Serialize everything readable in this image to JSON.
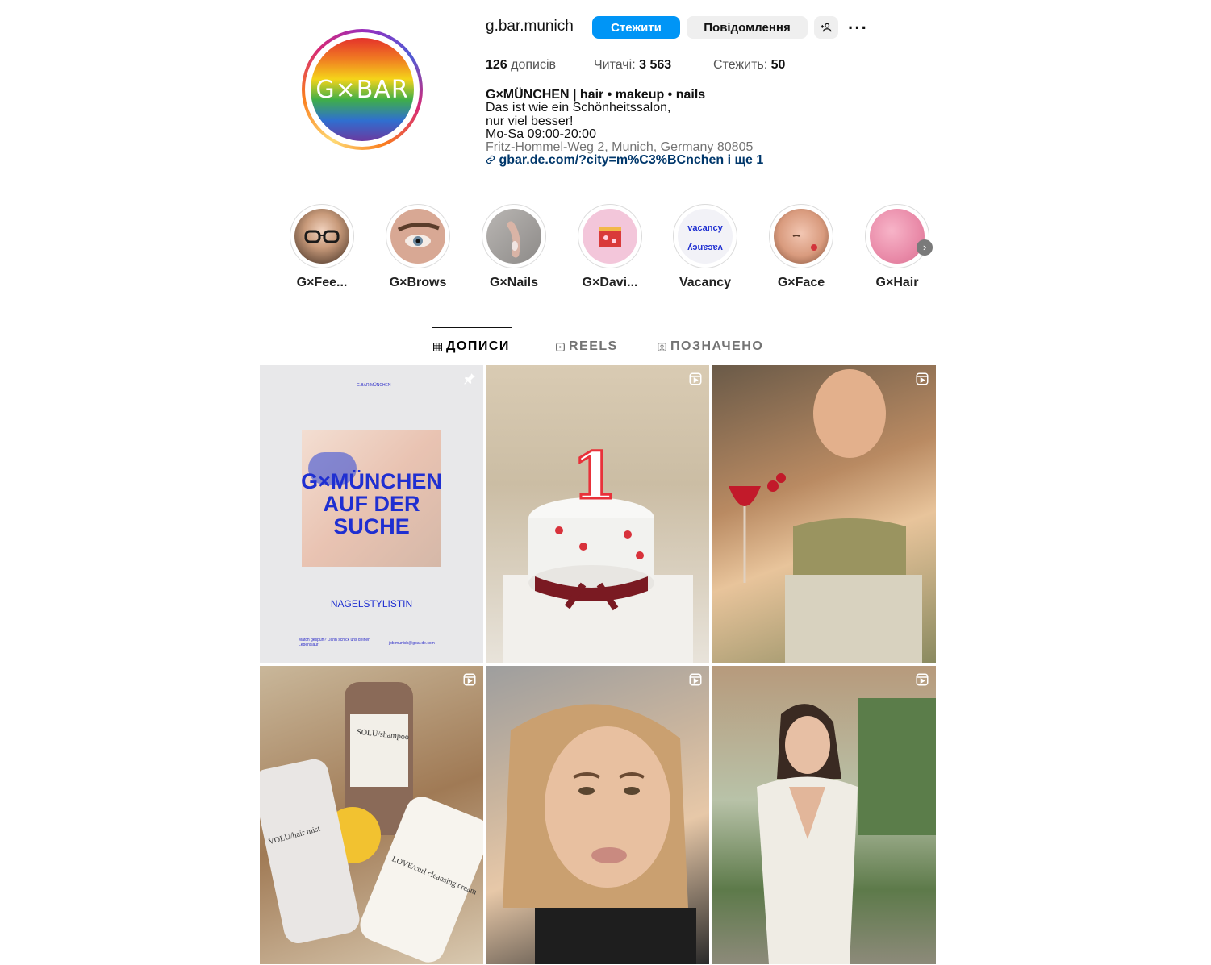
{
  "profile": {
    "username": "g.bar.munich",
    "avatar_text": "G×BAR",
    "follow_label": "Стежити",
    "message_label": "Повідомлення",
    "suggest_icon": "add-person-icon",
    "more_icon": "more-icon"
  },
  "stats": {
    "posts_count": "126",
    "posts_label": "дописів",
    "followers_label": "Читачі:",
    "followers_count": "3 563",
    "following_label": "Стежить:",
    "following_count": "50"
  },
  "bio": {
    "name": "G×MÜNCHEN | hair • makeup • nails",
    "line1": "Das ist wie ein Schönheitssalon,",
    "line2": "nur viel besser!",
    "hours": "Mo-Sa 09:00-20:00",
    "address": "Fritz-Hommel-Weg 2, Munich, Germany 80805",
    "link": "gbar.de.com/?city=m%C3%BCnchen і ще 1"
  },
  "highlights": [
    {
      "label": "G×Fee..."
    },
    {
      "label": "G×Brows"
    },
    {
      "label": "G×Nails"
    },
    {
      "label": "G×Davi..."
    },
    {
      "label": "Vacancy"
    },
    {
      "label": "G×Face"
    },
    {
      "label": "G×Hair"
    }
  ],
  "vacancy_art": {
    "text": "vacancy"
  },
  "tabs": {
    "posts": "ДОПИСИ",
    "reels": "REELS",
    "tagged": "ПОЗНАЧЕНО"
  },
  "posts": {
    "poster_brand": "G.BAR.MÜNCHEN",
    "poster_line1": "G×MÜNCHEN",
    "poster_line2": "AUF DER",
    "poster_line3": "SUCHE",
    "poster_sub": "NAGELSTYLISTIN",
    "poster_footer_left": "Match gespürt? Dann schick uns deinen Lebenslauf",
    "poster_footer_right": "job.munich@gbar.de.com",
    "cake_number": "1",
    "bottle1": "SOLU/shampoo",
    "bottle2": "VOLU/hair mist",
    "bottle3": "LOVE/curl cleansing cream"
  },
  "colors": {
    "accent": "#0095f6",
    "link": "#00376b",
    "poster_blue": "#1f2fd1"
  }
}
